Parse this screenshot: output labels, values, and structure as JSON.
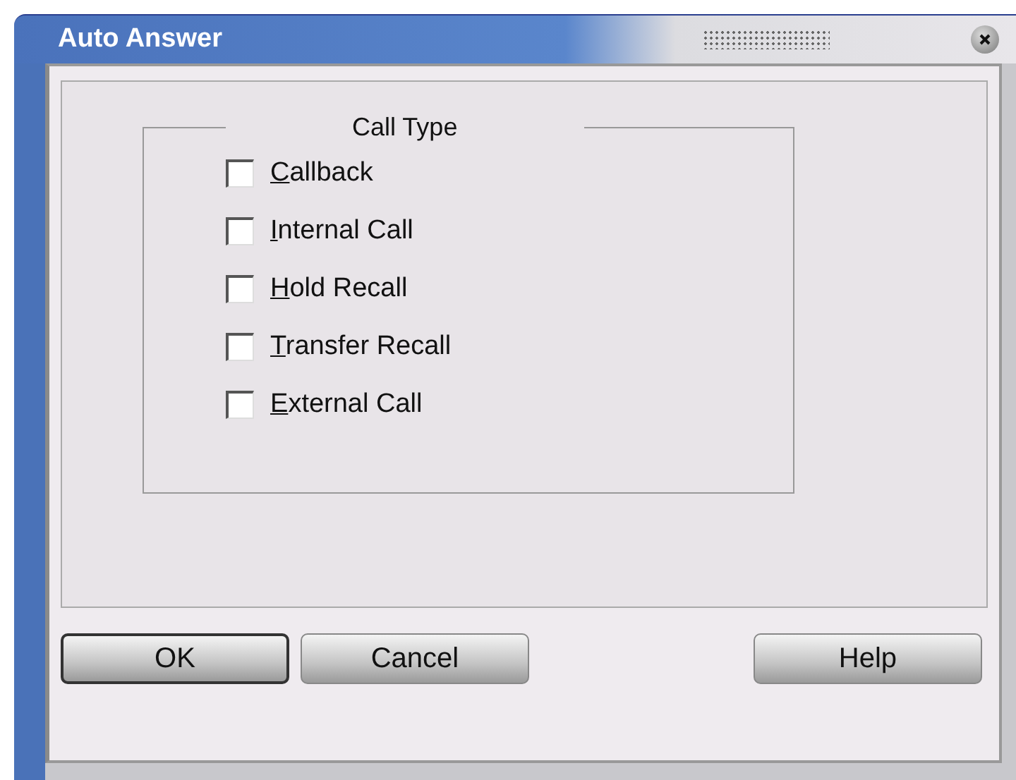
{
  "window": {
    "title": "Auto Answer"
  },
  "group": {
    "title": "Call Type",
    "options": [
      {
        "label": "Callback",
        "checked": false
      },
      {
        "label": "Internal Call",
        "checked": false
      },
      {
        "label": "Hold Recall",
        "checked": false
      },
      {
        "label": "Transfer Recall",
        "checked": false
      },
      {
        "label": "External Call",
        "checked": false
      }
    ]
  },
  "buttons": [
    {
      "label": "OK",
      "default": true
    },
    {
      "label": "Cancel",
      "default": false
    },
    {
      "label": "Help",
      "default": false
    }
  ]
}
